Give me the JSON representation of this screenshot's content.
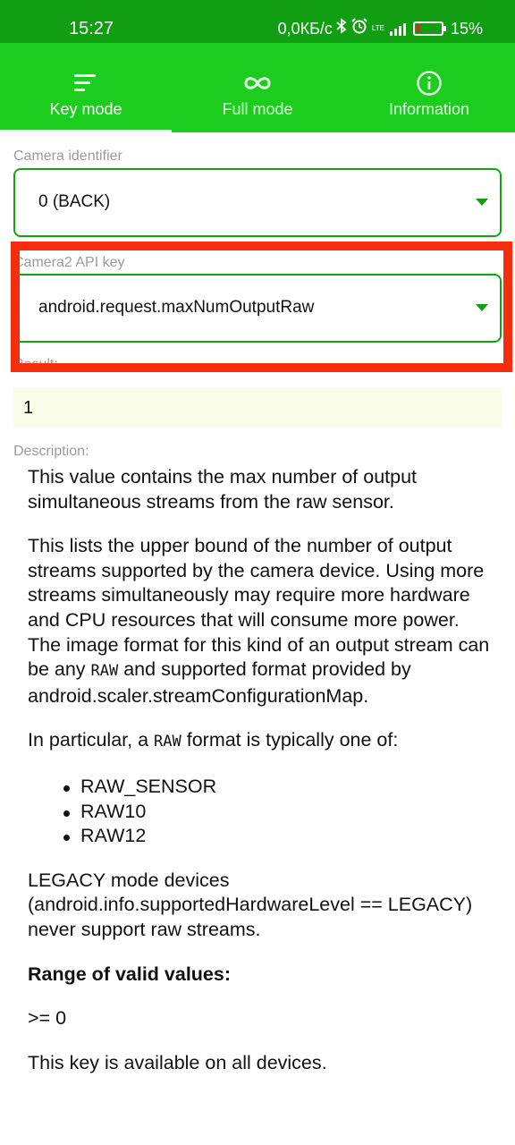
{
  "status_bar": {
    "time": "15:27",
    "network_speed": "0,0КБ/с",
    "network_type": "LTE",
    "battery": "15%"
  },
  "tabs": [
    {
      "label": "Key mode",
      "icon": "menu-icon",
      "active": true
    },
    {
      "label": "Full mode",
      "icon": "infinity-icon",
      "active": false
    },
    {
      "label": "Information",
      "icon": "info-icon",
      "active": false
    }
  ],
  "camera_identifier": {
    "label": "Camera identifier",
    "value": "0 (BACK)"
  },
  "api_key": {
    "label": "Camera2 API key",
    "value": "android.request.maxNumOutputRaw"
  },
  "result": {
    "label": "Result:",
    "value": "1"
  },
  "description": {
    "label": "Description:",
    "p1": "This value contains the max number of output simultaneous streams from the raw sensor.",
    "p2_a": "This lists the upper bound of the number of output streams supported by the camera device. Using more streams simultaneously may require more hardware and CPU resources that will consume more power. The image format for this kind of an output stream can be any ",
    "p2_code": "RAW",
    "p2_b": " and supported format provided by android.scaler.streamConfigurationMap.",
    "p3_a": "In particular, a ",
    "p3_code": "RAW",
    "p3_b": " format is typically one of:",
    "formats": [
      "RAW_SENSOR",
      "RAW10",
      "RAW12"
    ],
    "p4": "LEGACY mode devices (android.info.supportedHardwareLevel == LEGACY) never support raw streams.",
    "range_heading": "Range of valid values:",
    "range_value": ">= 0",
    "availability": "This key is available on all devices."
  },
  "colors": {
    "status_bar": "#129e12",
    "tab_bar": "#1dcd1d",
    "select_border": "#11a611",
    "highlight_box": "#f42d0c",
    "result_background": "#f9fde7"
  }
}
